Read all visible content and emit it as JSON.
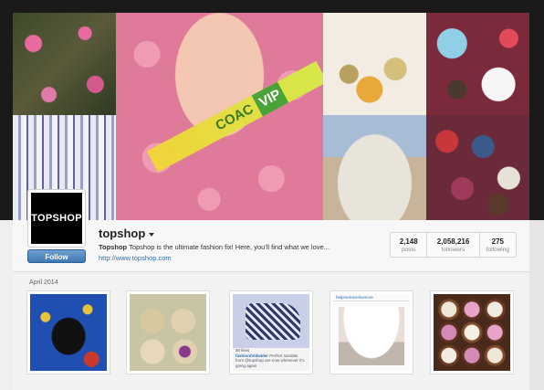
{
  "avatar": {
    "logo_text": "TOPSHOP"
  },
  "profile": {
    "username": "topshop",
    "bio_name": "Topshop",
    "bio_text": "Topshop is the ultimate fashion fix! Here, you'll find what we love...",
    "website": "http://www.topshop.com",
    "follow_label": "Follow"
  },
  "stats": {
    "posts": {
      "value": "2,148",
      "label": "posts"
    },
    "followers": {
      "value": "2,058,216",
      "label": "followers"
    },
    "following": {
      "value": "275",
      "label": "following"
    }
  },
  "cover": {
    "wristband_text": "COAC",
    "wristband_vip": "VIP"
  },
  "feed": {
    "month_label": "April 2014",
    "thumb3_caption_name": "30 likes",
    "thumb3_caption_user": "fashionfoldwider",
    "thumb3_caption_text": "Perfect sandals from @topshop are now whenever it's going again",
    "thumb4_header": "helpmetravelsomore"
  },
  "colors": {
    "accent_blue": "#3f78b2",
    "link_blue": "#2f6ea8",
    "frame_dark": "#1a1a1a"
  }
}
